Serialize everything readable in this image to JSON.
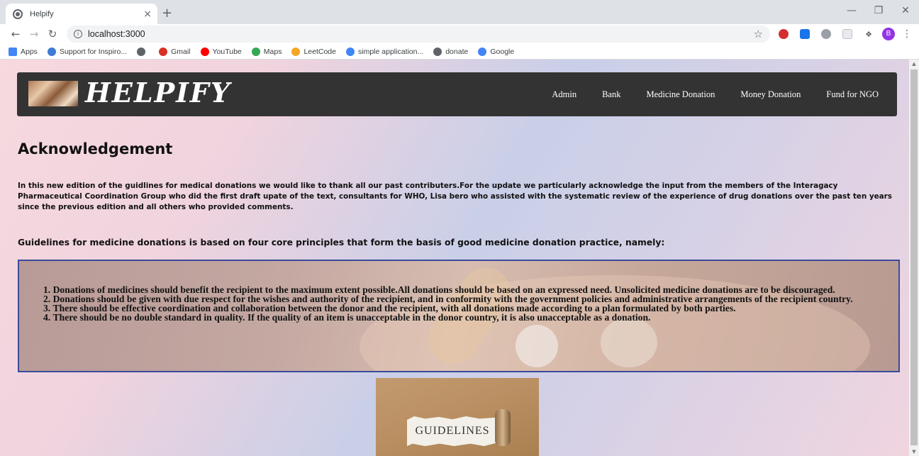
{
  "browser": {
    "tab_title": "Helpify",
    "tab_close": "×",
    "new_tab": "+",
    "url": "localhost:3000",
    "profile_initial": "B",
    "bookmarks": [
      {
        "label": "Apps",
        "color": "#4285f4"
      },
      {
        "label": "Support for Inspiro...",
        "color": "#3b7bd4"
      },
      {
        "label": "",
        "color": "#5f6368"
      },
      {
        "label": "Gmail",
        "color": "#d93025"
      },
      {
        "label": "YouTube",
        "color": "#ff0000"
      },
      {
        "label": "Maps",
        "color": "#34a853"
      },
      {
        "label": "LeetCode",
        "color": "#f5a623"
      },
      {
        "label": "simple application...",
        "color": "#4285f4"
      },
      {
        "label": "donate",
        "color": "#5f6368"
      },
      {
        "label": "Google",
        "color": "#4285f4"
      }
    ]
  },
  "header": {
    "logo_text": "HELPIFY",
    "nav": [
      "Admin",
      "Bank",
      "Medicine Donation",
      "Money Donation",
      "Fund for NGO"
    ]
  },
  "content": {
    "ack_title": "Acknowledgement",
    "ack_body": "In this new edition of the guidlines for medical donations we would like to thank all our past contributers.For the update we particularly acknowledge the input from the members of the Interagacy Pharmaceutical Coordination Group who did the first draft upate of the text, consultants for WHO, Lisa bero who assisted with the systematic review of the experience of drug donations over the past ten years since the previous edition and all others who provided comments.",
    "principles_heading": "Guidelines for medicine donations is based on four core principles that form the basis of good medicine donation practice, namely:",
    "principles": [
      "Donations of medicines should benefit the recipient to the maximum extent possible.All donations should be based on an expressed need. Unsolicited medicine donations are to be discouraged.",
      "Donations should be given with due respect for the wishes and authority of the recipient, and in conformity with the government policies and administrative arrangements of the recipient country.",
      "There should be effective coordination and collaboration between the donor and the recipient, with all donations made according to a plan formulated by both parties.",
      "There should be no double standard in quality. If the quality of an item is unacceptable in the donor country, it is also unacceptable as a donation."
    ],
    "image_label": "GUIDELINES"
  },
  "colors": {
    "header_bg": "#333333",
    "box_border": "#3b4b9a"
  }
}
